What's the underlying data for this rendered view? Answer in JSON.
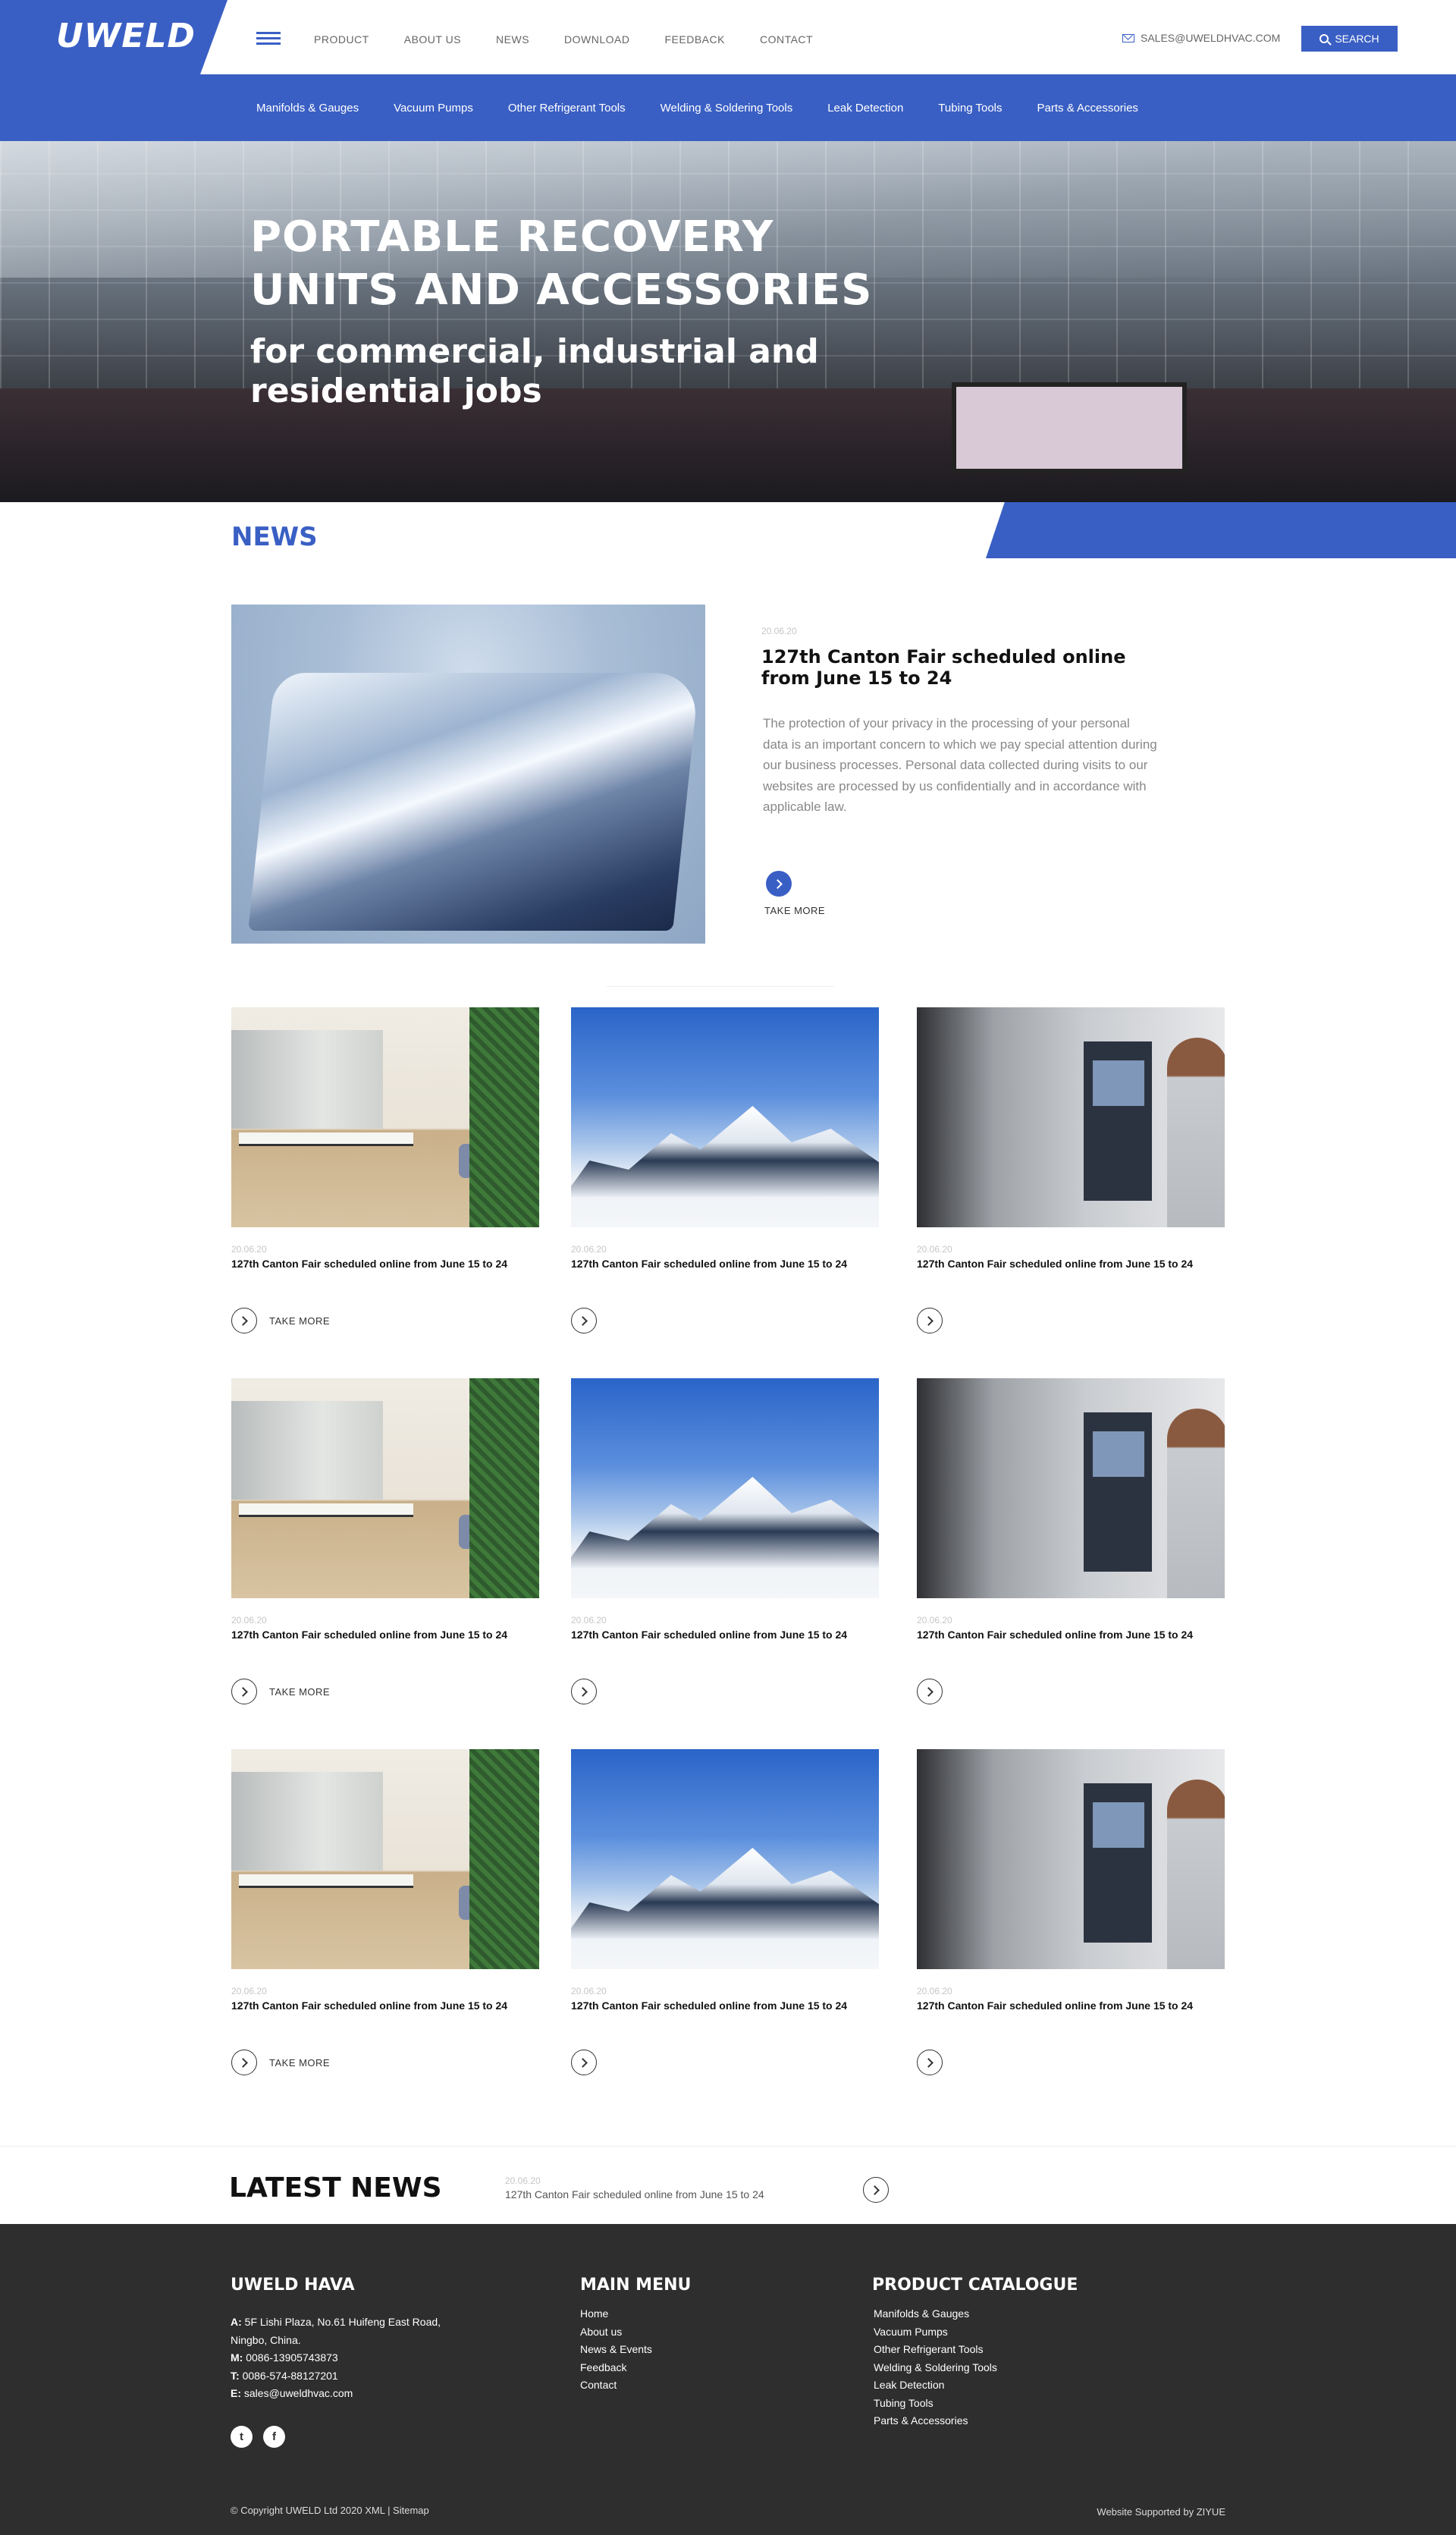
{
  "header": {
    "logo": "UWELD",
    "nav": [
      "PRODUCT",
      "ABOUT US",
      "NEWS",
      "DOWNLOAD",
      "FEEDBACK",
      "CONTACT"
    ],
    "email": "SALES@UWELDHVAC.COM",
    "search_label": "SEARCH"
  },
  "categories": [
    "Manifolds & Gauges",
    "Vacuum Pumps",
    "Other Refrigerant Tools",
    "Welding & Soldering Tools",
    "Leak Detection",
    "Tubing Tools",
    "Parts & Accessories"
  ],
  "hero": {
    "title_line1": "PORTABLE RECOVERY",
    "title_line2": "UNITS AND ACCESSORIES",
    "subtitle_line1": "for commercial, industrial and",
    "subtitle_line2": "residential jobs"
  },
  "news": {
    "heading": "NEWS",
    "featured": {
      "date": "20.06.20",
      "title": "127th Canton Fair scheduled online from June 15 to 24",
      "body": "The protection of your privacy in the processing of your personal data is an important concern to which we pay special attention during our business processes. Personal data collected during visits to our websites are processed by us confidentially and in accordance with applicable law.",
      "button_label": "TAKE MORE"
    },
    "cards": [
      {
        "date": "20.06.20",
        "title": "127th Canton Fair scheduled online from June 15 to 24",
        "take": "TAKE MORE",
        "image": "office"
      },
      {
        "date": "20.06.20",
        "title": "127th Canton Fair scheduled online from June 15 to 24",
        "take": "",
        "image": "snow-mountains"
      },
      {
        "date": "20.06.20",
        "title": "127th Canton Fair scheduled online from June 15 to 24",
        "take": "",
        "image": "machine-operator"
      },
      {
        "date": "20.06.20",
        "title": "127th Canton Fair scheduled online from June 15 to 24",
        "take": "TAKE MORE",
        "image": "office"
      },
      {
        "date": "20.06.20",
        "title": "127th Canton Fair scheduled online from June 15 to 24",
        "take": "",
        "image": "snow-mountains"
      },
      {
        "date": "20.06.20",
        "title": "127th Canton Fair scheduled online from June 15 to 24",
        "take": "",
        "image": "machine-operator"
      },
      {
        "date": "20.06.20",
        "title": "127th Canton Fair scheduled online from June 15 to 24",
        "take": "TAKE MORE",
        "image": "office"
      },
      {
        "date": "20.06.20",
        "title": "127th Canton Fair scheduled online from June 15 to 24",
        "take": "",
        "image": "snow-mountains"
      },
      {
        "date": "20.06.20",
        "title": "127th Canton Fair scheduled online from June 15 to 24",
        "take": "",
        "image": "machine-operator"
      }
    ]
  },
  "latest": {
    "heading": "LATEST NEWS",
    "date": "20.06.20",
    "text": "127th Canton Fair scheduled online from June 15 to 24"
  },
  "footer": {
    "company": {
      "heading": "UWELD HAVA",
      "address_label": "A:",
      "address_line1": "5F Lishi Plaza, No.61 Huifeng East Road,",
      "address_line2": "Ningbo, China.",
      "mobile_label": "M:",
      "mobile": "0086-13905743873",
      "tel_label": "T:",
      "tel": "0086-574-88127201",
      "email_label": "E:",
      "email": "sales@uweldhvac.com"
    },
    "main_menu": {
      "heading": "MAIN MENU",
      "items": [
        "Home",
        "About us",
        "News & Events",
        "Feedback",
        "Contact"
      ]
    },
    "catalogue": {
      "heading": "PRODUCT CATALOGUE",
      "items": [
        "Manifolds & Gauges",
        "Vacuum Pumps",
        "Other Refrigerant Tools",
        "Welding & Soldering Tools",
        "Leak Detection",
        "Tubing Tools",
        "Parts & Accessories"
      ]
    },
    "social": [
      "twitter-icon",
      "facebook-icon"
    ],
    "copyright": "© Copyright UWELD Ltd 2020   XML | Sitemap",
    "supported": "Website Supported by ZIYUE"
  },
  "colors": {
    "brand_blue": "#3a5fc4",
    "footer_bg": "#2e2e2e"
  }
}
